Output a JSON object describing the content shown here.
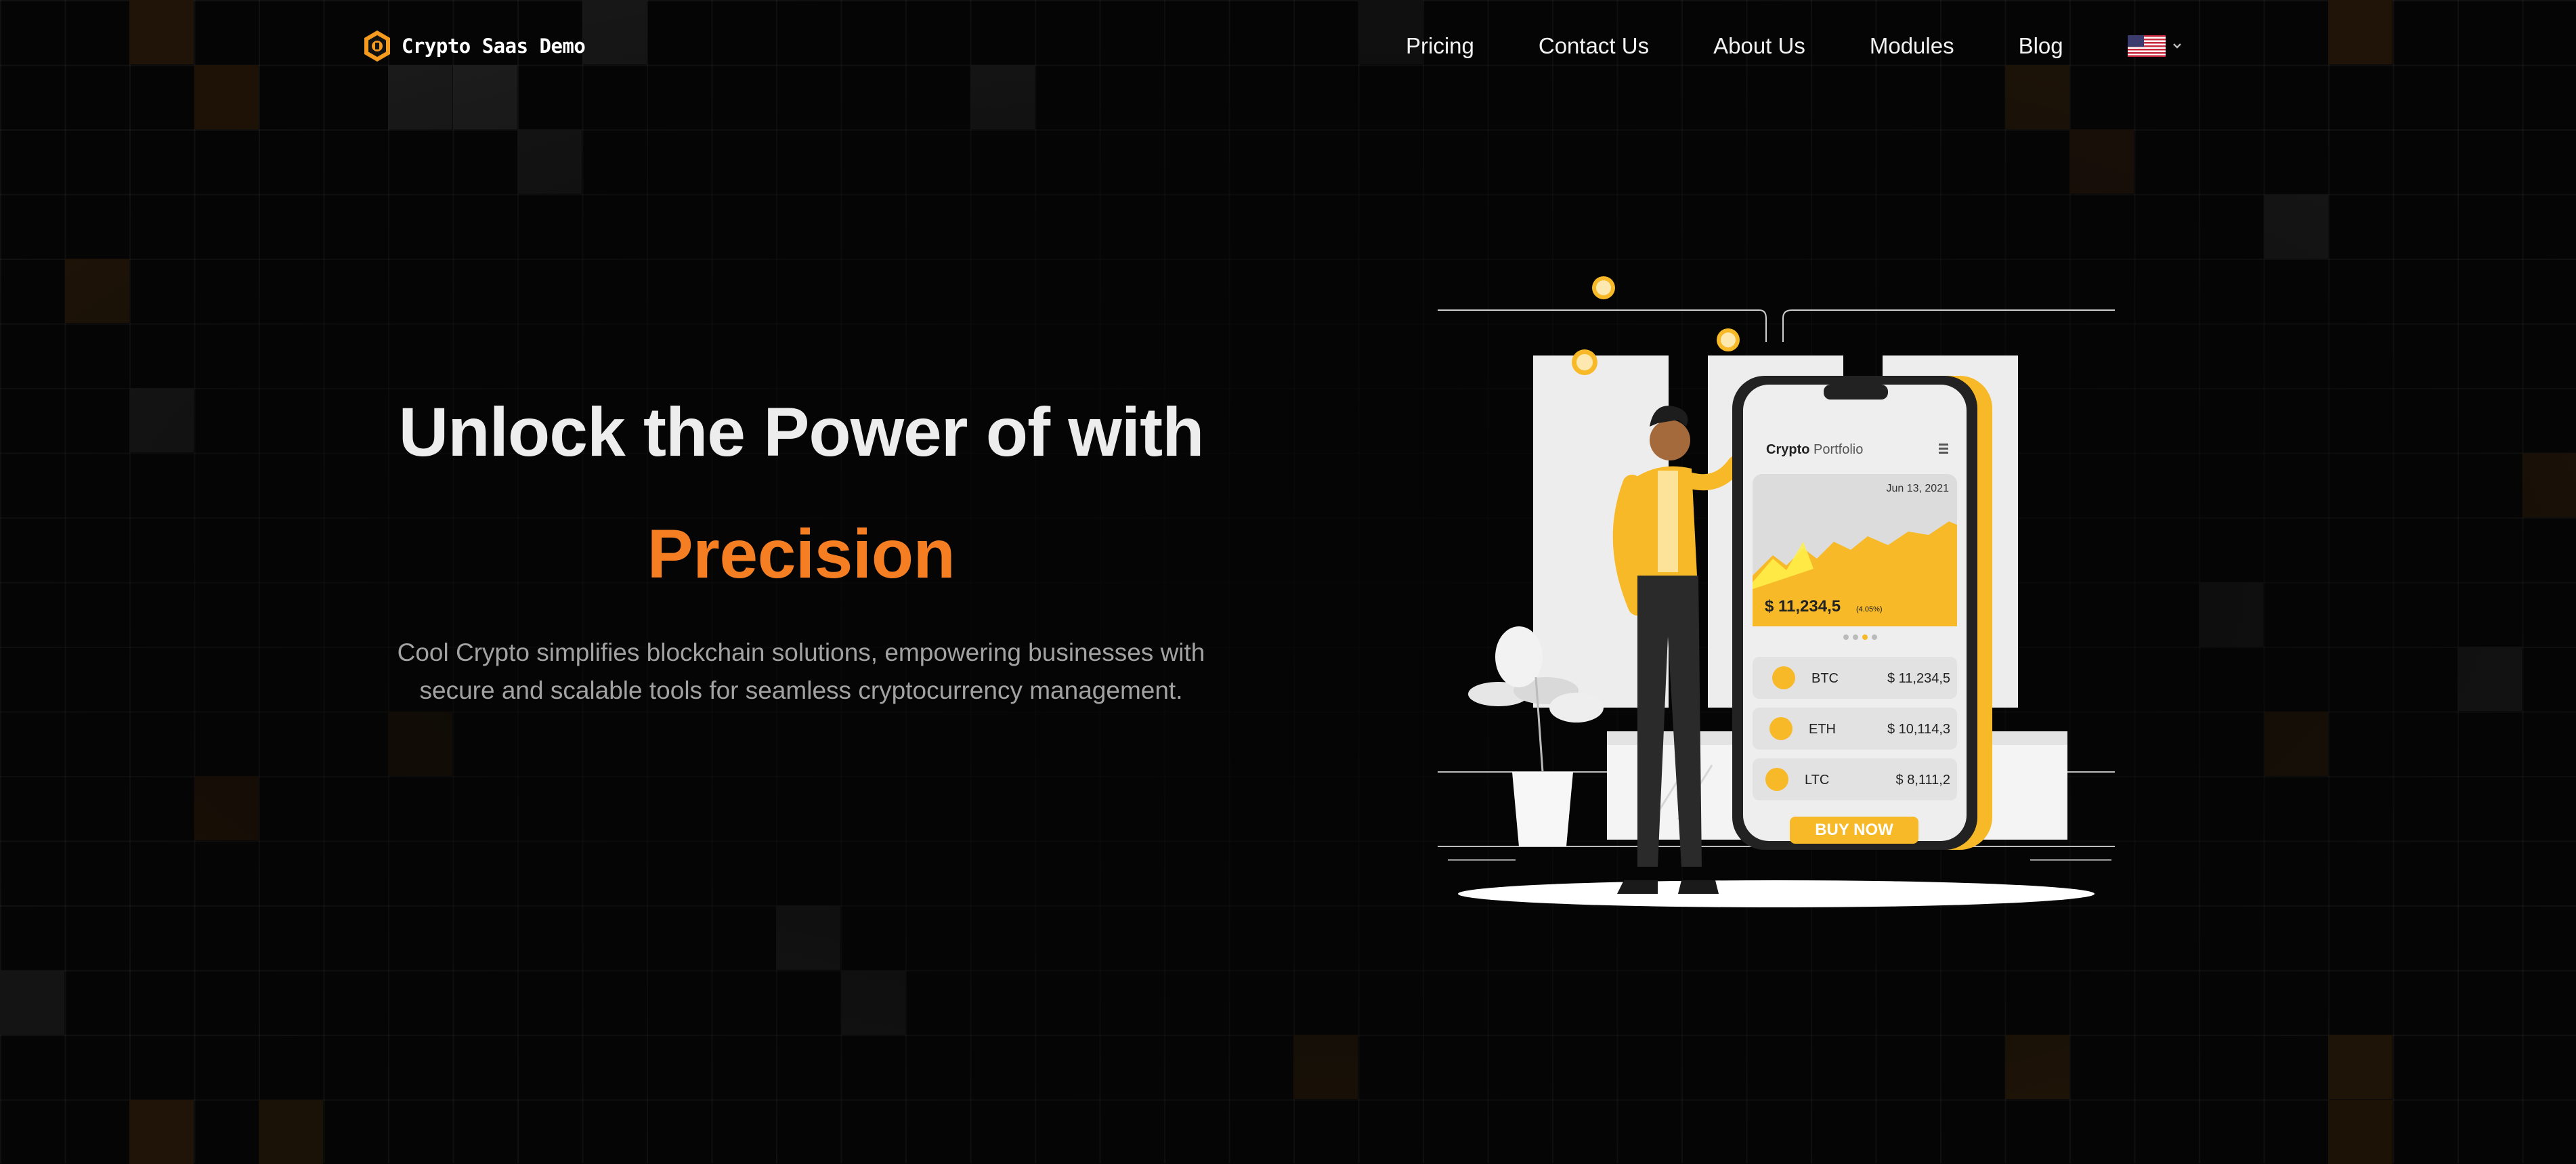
{
  "brand": {
    "name": "Crypto Saas Demo",
    "icon": "hexagon-coin-icon",
    "accent_color": "#f39a1f"
  },
  "nav": {
    "links": [
      "Pricing",
      "Contact Us",
      "About Us",
      "Modules",
      "Blog"
    ],
    "language": {
      "icon": "us-flag-icon",
      "dropdown_icon": "chevron-down-icon"
    }
  },
  "hero": {
    "title": "Unlock the Power of with",
    "accent": "Precision",
    "accent_color": "#f47e21",
    "subtitle_line1": "Cool Crypto simplifies blockchain solutions, empowering businesses with",
    "subtitle_line2": "secure and scalable tools for seamless cryptocurrency management."
  },
  "illustration": {
    "app_title_bold": "Crypto",
    "app_title": "Portfolio",
    "date": "Jun 13, 2021",
    "balance": "$ 11,234,5",
    "balance_change": "(4.05%)",
    "coins": [
      {
        "symbol": "BTC",
        "price": "$ 11,234,5",
        "icon": "bitcoin-icon"
      },
      {
        "symbol": "ETH",
        "price": "$ 10,114,3",
        "icon": "ethereum-icon"
      },
      {
        "symbol": "LTC",
        "price": "$ 8,111,2",
        "icon": "litecoin-icon"
      }
    ],
    "cta": "BUY NOW",
    "theme_color": "#f7b928"
  }
}
